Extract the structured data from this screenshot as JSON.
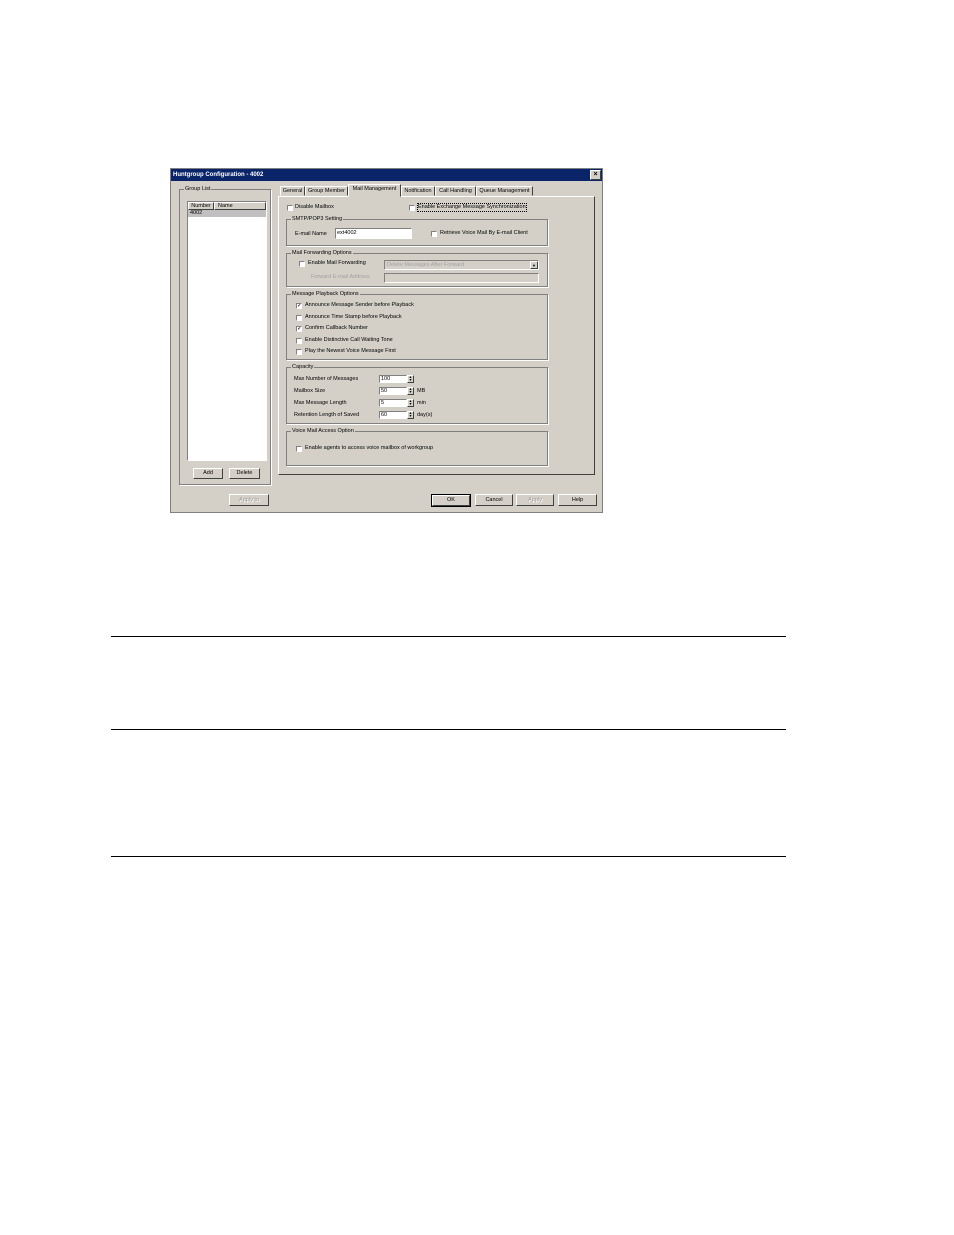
{
  "window": {
    "title": "Huntgroup Configuration - 4002",
    "close_icon": "×"
  },
  "group_list": {
    "label": "Group List",
    "columns": [
      "Number",
      "Name"
    ],
    "rows": [
      {
        "number": "4002",
        "name": ""
      }
    ],
    "add_label": "Add",
    "delete_label": "Delete"
  },
  "tabs": [
    {
      "label": "General",
      "active": false
    },
    {
      "label": "Group Member",
      "active": false
    },
    {
      "label": "Mail Management",
      "active": true
    },
    {
      "label": "Notification",
      "active": false
    },
    {
      "label": "Call Handling",
      "active": false
    },
    {
      "label": "Queue Management",
      "active": false
    }
  ],
  "mail": {
    "disable_mailbox": {
      "label": "Disable Mailbox",
      "checked": false
    },
    "exchange_sync": {
      "label": "Enable Exchange Message Synchronization",
      "checked": false
    },
    "smtp": {
      "label": "SMTP/POP3 Setting",
      "email_label": "E-mail Name",
      "email_value": "ext4002",
      "retrieve_label": "Retrieve Voice Mail By E-mail Client",
      "retrieve_checked": false
    },
    "forwarding": {
      "label": "Mail Forwarding Options",
      "enable_label": "Enable Mail Forwarding",
      "enable_checked": false,
      "action_value": "Delete Messages After Forward",
      "forward_label": "Forward E-mail Address",
      "forward_value": ""
    },
    "playback": {
      "label": "Message Playback Options",
      "options": [
        {
          "label": "Announce Message Sender before Playback",
          "checked": true
        },
        {
          "label": "Announce Time Stamp before Playback",
          "checked": false
        },
        {
          "label": "Confirm Callback Number",
          "checked": true
        },
        {
          "label": "Enable Distinctive Call Waiting Tone",
          "checked": false
        },
        {
          "label": "Play the Newest Voice Message First",
          "checked": false
        }
      ]
    },
    "capacity": {
      "label": "Capacity",
      "fields": [
        {
          "label": "Max Number of Messages",
          "value": "100",
          "unit": ""
        },
        {
          "label": "Mailbox Size",
          "value": "50",
          "unit": "MB"
        },
        {
          "label": "Max Message Length",
          "value": "5",
          "unit": "min"
        },
        {
          "label": "Retention Length of Saved",
          "value": "60",
          "unit": "day(s)"
        }
      ]
    },
    "voice_access": {
      "label": "Voice Mail Access Option",
      "enable_label": "Enable agents to access voice mailbox of workgroup",
      "enable_checked": false
    }
  },
  "buttons": {
    "apply_to": "Apply to",
    "ok": "OK",
    "cancel": "Cancel",
    "apply": "Apply",
    "help": "Help"
  },
  "glyphs": {
    "check": "✓",
    "spin_up": "▲",
    "spin_down": "▼",
    "dropdown": "▼"
  }
}
